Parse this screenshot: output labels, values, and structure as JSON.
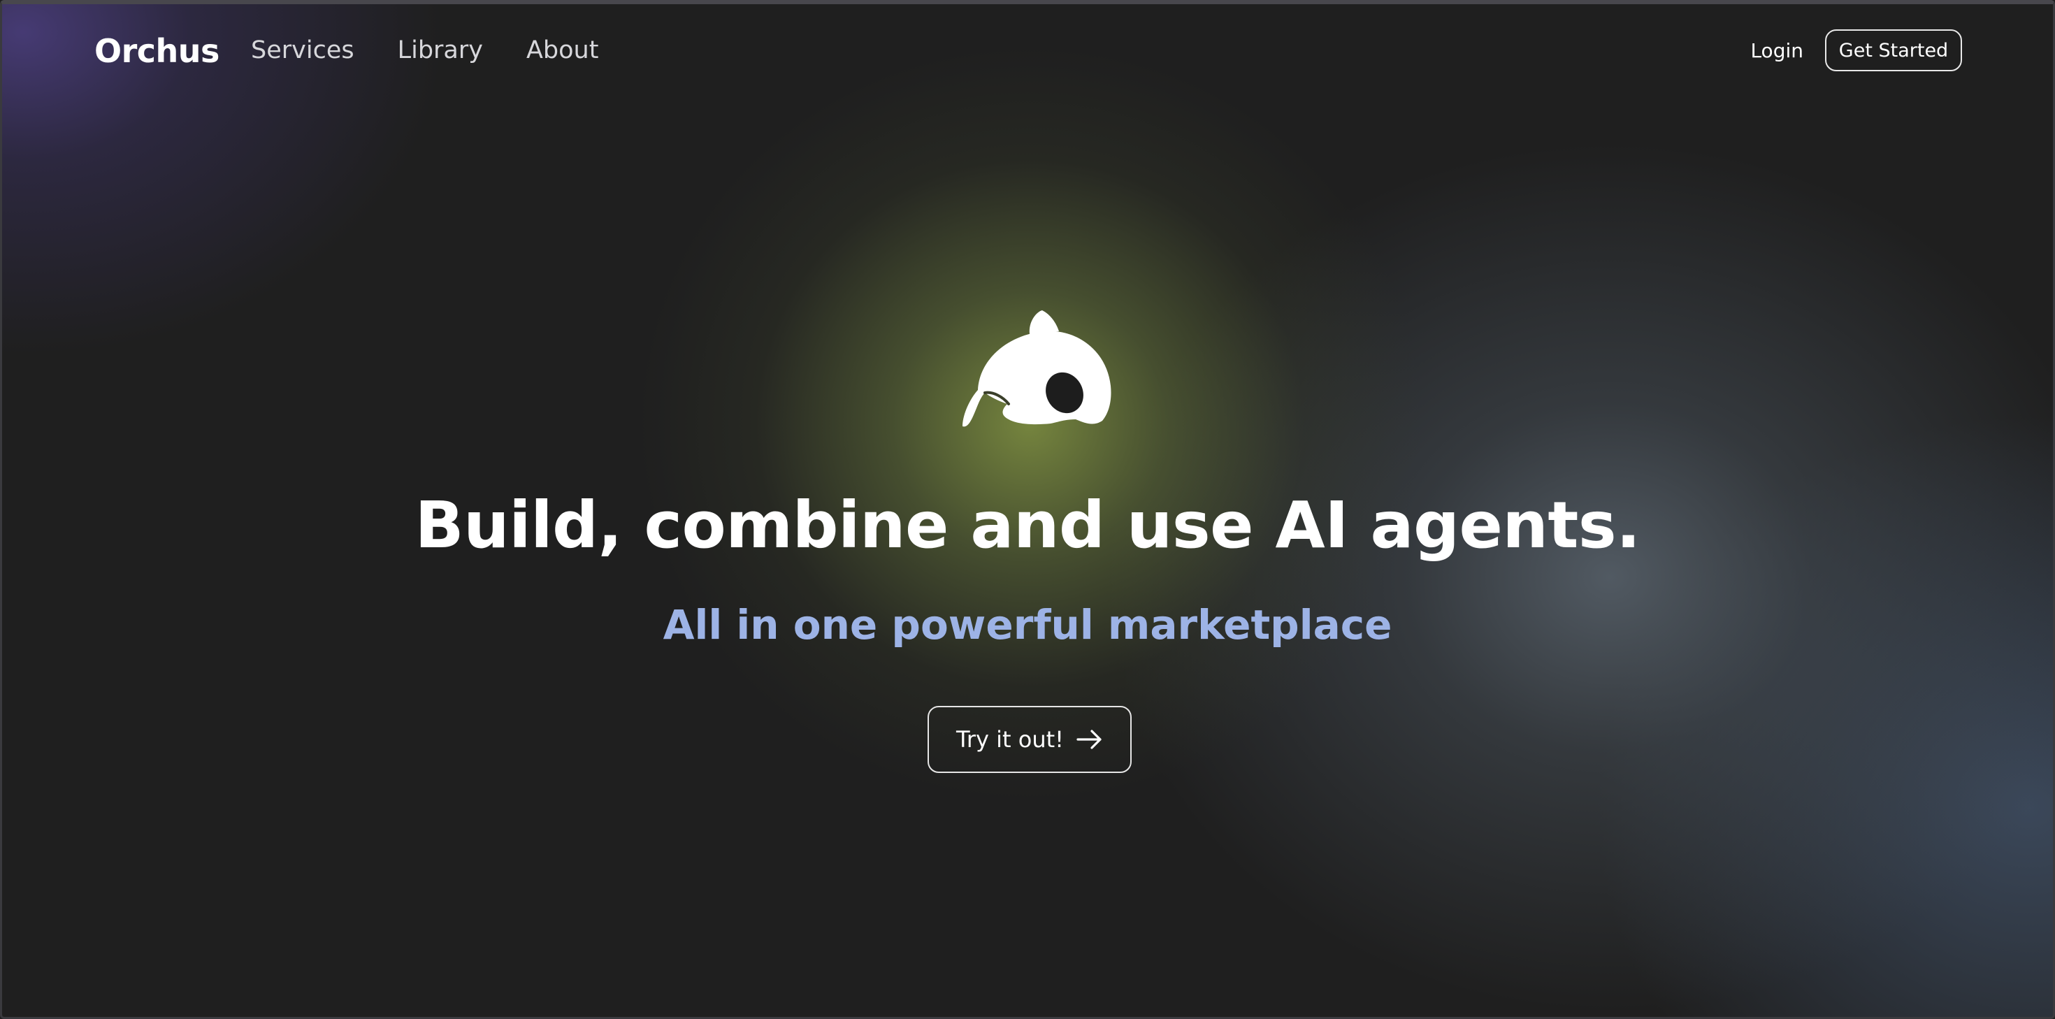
{
  "brand": {
    "name": "Orchus"
  },
  "nav": {
    "links": [
      {
        "label": "Services"
      },
      {
        "label": "Library"
      },
      {
        "label": "About"
      }
    ],
    "login_label": "Login",
    "get_started_label": "Get Started"
  },
  "hero": {
    "logo_icon": "orca-icon",
    "headline": "Build, combine and use AI agents.",
    "subheadline": "All in one powerful marketplace",
    "cta_label": "Try it out!",
    "cta_icon": "arrow-right-icon"
  },
  "colors": {
    "background": "#1f1f1f",
    "accent_subheadline": "#9db3e6",
    "glow_center": "#7a8a40",
    "glow_top_left": "#483c78",
    "text": "#ffffff"
  }
}
